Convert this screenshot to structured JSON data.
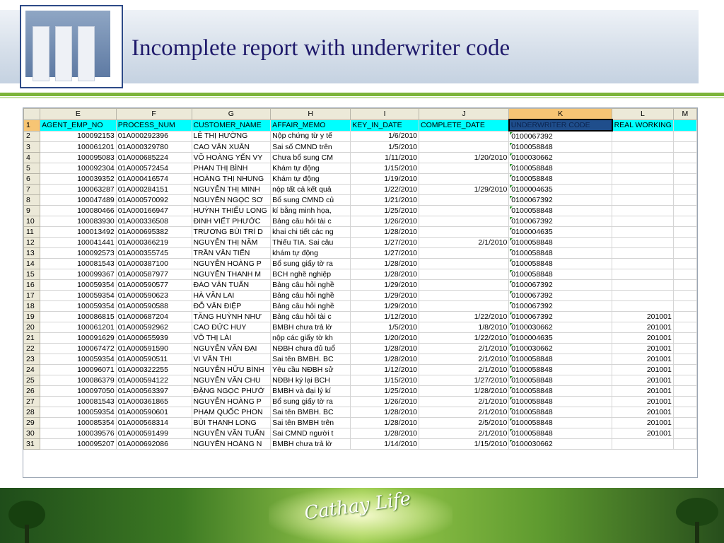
{
  "slide": {
    "title": "Incomplete report with underwriter code",
    "footer_logo_text": "Cathay Life"
  },
  "colors": {
    "title": "#1f1a6b",
    "header_row_fill": "#00ffff",
    "selected_column": "#f7c574",
    "footer_green": "#7cb43a"
  },
  "sheet": {
    "col_letters": [
      "E",
      "F",
      "G",
      "H",
      "I",
      "J",
      "K",
      "L",
      "M"
    ],
    "header_row": {
      "num": "1",
      "cells": [
        "AGENT_EMP_NO",
        "PROCESS_NUM",
        "CUSTOMER_NAME",
        "AFFAIR_MEMO",
        "KEY_IN_DATE",
        "COMPLETE_DATE",
        "UNDERWRITER CODE",
        "REAL WORKING",
        ""
      ]
    },
    "rows": [
      {
        "n": "2",
        "emp": "100092153",
        "proc": "01A000292396",
        "cust": "LÊ THỊ HƯỜNG",
        "memo": "Nộp chứng từ y tế",
        "key": "1/6/2010",
        "comp": "",
        "code": "0100067392",
        "real": ""
      },
      {
        "n": "3",
        "emp": "100061201",
        "proc": "01A000329780",
        "cust": "CAO VĂN XUÂN",
        "memo": "Sai số CMND trên",
        "key": "1/5/2010",
        "comp": "",
        "code": "0100058848",
        "real": ""
      },
      {
        "n": "4",
        "emp": "100095083",
        "proc": "01A000685224",
        "cust": "VÕ HOÀNG YẾN VY",
        "memo": "Chưa bổ sung CM",
        "key": "1/11/2010",
        "comp": "1/20/2010",
        "code": "0100030662",
        "real": ""
      },
      {
        "n": "5",
        "emp": "100092304",
        "proc": "01A000572454",
        "cust": "PHAN THỊ BÌNH",
        "memo": "Khám tự động",
        "key": "1/15/2010",
        "comp": "",
        "code": "0100058848",
        "real": ""
      },
      {
        "n": "6",
        "emp": "100039352",
        "proc": "01A000416574",
        "cust": "HOÀNG THỊ NHUNG",
        "memo": "Khám tự động",
        "key": "1/19/2010",
        "comp": "",
        "code": "0100058848",
        "real": ""
      },
      {
        "n": "7",
        "emp": "100063287",
        "proc": "01A000284151",
        "cust": "NGUYỄN THỊ MINH",
        "memo": "nộp tất cả kết quả",
        "key": "1/22/2010",
        "comp": "1/29/2010",
        "code": "0100004635",
        "real": ""
      },
      {
        "n": "8",
        "emp": "100047489",
        "proc": "01A000570092",
        "cust": "NGUYỄN NGỌC SƠ",
        "memo": "Bổ sung CMND củ",
        "key": "1/21/2010",
        "comp": "",
        "code": "0100067392",
        "real": ""
      },
      {
        "n": "9",
        "emp": "100080466",
        "proc": "01A000166947",
        "cust": "HUỲNH THIẾU LONG",
        "memo": "kí bằng minh họa,",
        "key": "1/25/2010",
        "comp": "",
        "code": "0100058848",
        "real": ""
      },
      {
        "n": "10",
        "emp": "100083930",
        "proc": "01A000336508",
        "cust": "ĐINH VIẾT PHƯỚC",
        "memo": "Bảng câu hỏi tài c",
        "key": "1/26/2010",
        "comp": "",
        "code": "0100067392",
        "real": ""
      },
      {
        "n": "11",
        "emp": "100013492",
        "proc": "01A000695382",
        "cust": "TRƯƠNG BÙI TRÍ D",
        "memo": "khai chi tiết các ng",
        "key": "1/28/2010",
        "comp": "",
        "code": "0100004635",
        "real": ""
      },
      {
        "n": "12",
        "emp": "100041441",
        "proc": "01A000366219",
        "cust": "NGUYỄN THỊ NĂM",
        "memo": "Thiếu TIA. Sai câu",
        "key": "1/27/2010",
        "comp": "2/1/2010",
        "code": "0100058848",
        "real": ""
      },
      {
        "n": "13",
        "emp": "100092573",
        "proc": "01A000355745",
        "cust": "TRẦN VĂN TIẾN",
        "memo": "khám tự động",
        "key": "1/27/2010",
        "comp": "",
        "code": "0100058848",
        "real": ""
      },
      {
        "n": "14",
        "emp": "100081543",
        "proc": "01A000387100",
        "cust": "NGUYỄN HOÀNG P",
        "memo": "Bổ sung giấy tờ ra",
        "key": "1/28/2010",
        "comp": "",
        "code": "0100058848",
        "real": ""
      },
      {
        "n": "15",
        "emp": "100099367",
        "proc": "01A000587977",
        "cust": "NGUYỄN THANH M",
        "memo": "BCH nghề nghiệp",
        "key": "1/28/2010",
        "comp": "",
        "code": "0100058848",
        "real": ""
      },
      {
        "n": "16",
        "emp": "100059354",
        "proc": "01A000590577",
        "cust": "ĐÀO VĂN TUẤN",
        "memo": "Bảng câu hỏi nghề",
        "key": "1/29/2010",
        "comp": "",
        "code": "0100067392",
        "real": ""
      },
      {
        "n": "17",
        "emp": "100059354",
        "proc": "01A000590623",
        "cust": "HÀ VĂN LAI",
        "memo": "Bảng câu hỏi nghề",
        "key": "1/29/2010",
        "comp": "",
        "code": "0100067392",
        "real": ""
      },
      {
        "n": "18",
        "emp": "100059354",
        "proc": "01A000590588",
        "cust": "ĐỖ VĂN ĐIỆP",
        "memo": "Bảng câu hỏi nghề",
        "key": "1/29/2010",
        "comp": "",
        "code": "0100067392",
        "real": ""
      },
      {
        "n": "19",
        "emp": "100086815",
        "proc": "01A000687204",
        "cust": "TĂNG HUỲNH NHƯ",
        "memo": "Bảng câu hỏi tài c",
        "key": "1/12/2010",
        "comp": "1/22/2010",
        "code": "0100067392",
        "real": "201001"
      },
      {
        "n": "20",
        "emp": "100061201",
        "proc": "01A000592962",
        "cust": "CAO ĐỨC HUY",
        "memo": "BMBH chưa trả lờ",
        "key": "1/5/2010",
        "comp": "1/8/2010",
        "code": "0100030662",
        "real": "201001"
      },
      {
        "n": "21",
        "emp": "100091629",
        "proc": "01A000655939",
        "cust": "VÕ THỊ LÀI",
        "memo": "nộp các giấy tờ kh",
        "key": "1/20/2010",
        "comp": "1/22/2010",
        "code": "0100004635",
        "real": "201001"
      },
      {
        "n": "22",
        "emp": "100067472",
        "proc": "01A000591590",
        "cust": "NGUYỄN VĂN ĐẠI",
        "memo": "NĐBH chưa đủ tuổ",
        "key": "1/28/2010",
        "comp": "2/1/2010",
        "code": "0100030662",
        "real": "201001"
      },
      {
        "n": "23",
        "emp": "100059354",
        "proc": "01A000590511",
        "cust": "VI VĂN THI",
        "memo": "Sai tên BMBH. BC",
        "key": "1/28/2010",
        "comp": "2/1/2010",
        "code": "0100058848",
        "real": "201001"
      },
      {
        "n": "24",
        "emp": "100096071",
        "proc": "01A000322255",
        "cust": "NGUYỄN HỮU BÌNH",
        "memo": "Yêu cầu NĐBH sử",
        "key": "1/12/2010",
        "comp": "2/1/2010",
        "code": "0100058848",
        "real": "201001"
      },
      {
        "n": "25",
        "emp": "100086379",
        "proc": "01A000594122",
        "cust": "NGUYỄN VĂN CHU",
        "memo": "NĐBH ký lại BCH",
        "key": "1/15/2010",
        "comp": "1/27/2010",
        "code": "0100058848",
        "real": "201001"
      },
      {
        "n": "26",
        "emp": "100097050",
        "proc": "01A000563397",
        "cust": "ĐẶNG NGỌC PHƯỚ",
        "memo": "BMBH và đại lý kí",
        "key": "1/25/2010",
        "comp": "1/28/2010",
        "code": "0100058848",
        "real": "201001"
      },
      {
        "n": "27",
        "emp": "100081543",
        "proc": "01A000361865",
        "cust": "NGUYỄN HOÀNG P",
        "memo": "Bổ sung giấy tờ ra",
        "key": "1/26/2010",
        "comp": "2/1/2010",
        "code": "0100058848",
        "real": "201001"
      },
      {
        "n": "28",
        "emp": "100059354",
        "proc": "01A000590601",
        "cust": "PHẠM QUỐC PHON",
        "memo": "Sai tên BMBH. BC",
        "key": "1/28/2010",
        "comp": "2/1/2010",
        "code": "0100058848",
        "real": "201001"
      },
      {
        "n": "29",
        "emp": "100085354",
        "proc": "01A000568314",
        "cust": "BÙI THANH LONG",
        "memo": "Sai tên BMBH trên",
        "key": "1/28/2010",
        "comp": "2/5/2010",
        "code": "0100058848",
        "real": "201001"
      },
      {
        "n": "30",
        "emp": "100039576",
        "proc": "01A000591499",
        "cust": "NGUYỄN VĂN TUẤN",
        "memo": "Sai CMND người t",
        "key": "1/28/2010",
        "comp": "2/1/2010",
        "code": "0100058848",
        "real": "201001"
      },
      {
        "n": "31",
        "emp": "100095207",
        "proc": "01A000692086",
        "cust": "NGUYỄN HOÀNG N",
        "memo": "BMBH chưa trả lờ",
        "key": "1/14/2010",
        "comp": "1/15/2010",
        "code": "0100030662",
        "real": ""
      }
    ]
  }
}
